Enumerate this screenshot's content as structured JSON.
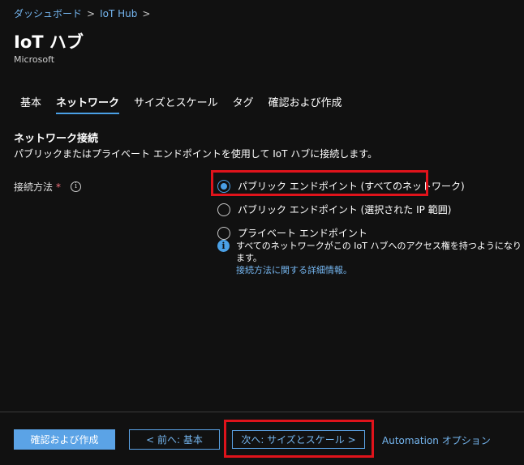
{
  "breadcrumb": {
    "items": [
      "ダッシュボード",
      "IoT Hub"
    ],
    "separator": ">"
  },
  "header": {
    "title": "IoT ハブ",
    "subtitle": "Microsoft"
  },
  "tabs": [
    {
      "label": "基本"
    },
    {
      "label": "ネットワーク",
      "active": true
    },
    {
      "label": "サイズとスケール"
    },
    {
      "label": "タグ"
    },
    {
      "label": "確認および作成"
    }
  ],
  "section": {
    "title": "ネットワーク接続",
    "description": "パブリックまたはプライベート エンドポイントを使用して IoT ハブに接続します。"
  },
  "connectivity": {
    "label": "接続方法",
    "required_mark": "*",
    "info_icon": "i",
    "options": [
      {
        "label": "パブリック エンドポイント (すべてのネットワーク)",
        "selected": true
      },
      {
        "label": "パブリック エンドポイント (選択された IP 範囲)",
        "selected": false
      },
      {
        "label": "プライベート エンドポイント",
        "selected": false
      }
    ],
    "info_text": "すべてのネットワークがこの IoT ハブへのアクセス権を持つようになります。",
    "info_link": "接続方法に関する詳細情報。",
    "info_glyph": "i"
  },
  "footer": {
    "review_create_label": "確認および作成",
    "prev_label": "< 前へ: 基本",
    "next_label": "次へ: サイズとスケール >",
    "automation_label": "Automation オプション"
  },
  "colors": {
    "accent": "#4aa0e6",
    "link": "#75b6f0",
    "highlight": "#e0131b",
    "background": "#111111"
  }
}
